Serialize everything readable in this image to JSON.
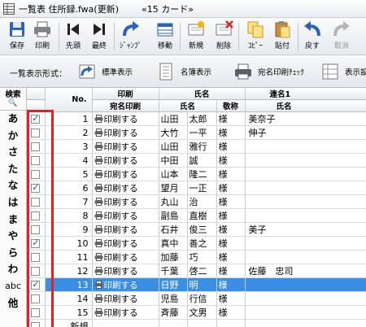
{
  "titlebar": {
    "line1": "一覧表  住所録.fwa(更新)",
    "line2": "«15 カード»"
  },
  "toolbar": [
    {
      "label": "保存",
      "icon": "save-icon",
      "enabled": true
    },
    {
      "label": "印刷",
      "icon": "printer-icon",
      "enabled": true
    },
    {
      "label": "先頭",
      "icon": "first-icon",
      "enabled": true
    },
    {
      "label": "最終",
      "icon": "last-icon",
      "enabled": true
    },
    {
      "label": "ｼﾞｬﾝﾌﾟ",
      "icon": "jump-icon",
      "enabled": true
    },
    {
      "label": "移動",
      "icon": "move-icon",
      "enabled": true
    },
    {
      "label": "新規",
      "icon": "new-card-icon",
      "enabled": true
    },
    {
      "label": "削除",
      "icon": "delete-card-icon",
      "enabled": true
    },
    {
      "label": "ｺﾋﾟｰ",
      "icon": "copy-icon",
      "enabled": true
    },
    {
      "label": "貼付",
      "icon": "paste-icon",
      "enabled": true
    },
    {
      "label": "戻す",
      "icon": "undo-icon",
      "enabled": true
    },
    {
      "label": "取消",
      "icon": "redo-icon",
      "enabled": false
    }
  ],
  "viewbar": {
    "label": "一覧表示形式：",
    "options": [
      {
        "label": "標準表示",
        "icon": "standard-view-icon"
      },
      {
        "label": "名簿表示",
        "icon": "roster-view-icon"
      },
      {
        "label": "宛名印刷ﾁｪｯｸ",
        "icon": "address-print-check-icon"
      },
      {
        "label": "表示設",
        "icon": "display-settings-icon"
      }
    ]
  },
  "index": {
    "header_line1": "検索",
    "header_line2": "🔍",
    "keys": [
      "あ",
      "か",
      "さ",
      "た",
      "な",
      "は",
      "ま",
      "や",
      "ら",
      "わ",
      "abc",
      "他"
    ]
  },
  "grid": {
    "group_headers": {
      "print": "印刷",
      "name": "氏名",
      "joint": "連名1"
    },
    "columns": {
      "no": "No.",
      "address_print": "宛名印刷",
      "name": "氏名",
      "honorific": "敬称",
      "joint_name": "氏名"
    },
    "rows": [
      {
        "checked": true,
        "no": "1",
        "print": "印刷する",
        "last": "山田",
        "first": "太郎",
        "hon": "様",
        "joint": "美奈子"
      },
      {
        "checked": false,
        "no": "2",
        "print": "印刷する",
        "last": "大竹",
        "first": "一平",
        "hon": "様",
        "joint": "伸子"
      },
      {
        "checked": false,
        "no": "3",
        "print": "印刷する",
        "last": "山田",
        "first": "雅行",
        "hon": "様",
        "joint": ""
      },
      {
        "checked": false,
        "no": "4",
        "print": "印刷する",
        "last": "中田",
        "first": "誠",
        "hon": "様",
        "joint": ""
      },
      {
        "checked": false,
        "no": "5",
        "print": "印刷する",
        "last": "山本",
        "first": "隆二",
        "hon": "様",
        "joint": ""
      },
      {
        "checked": true,
        "no": "6",
        "print": "印刷する",
        "last": "望月",
        "first": "一正",
        "hon": "様",
        "joint": ""
      },
      {
        "checked": false,
        "no": "7",
        "print": "印刷する",
        "last": "丸山",
        "first": "治",
        "hon": "様",
        "joint": ""
      },
      {
        "checked": false,
        "no": "8",
        "print": "印刷する",
        "last": "副島",
        "first": "直樹",
        "hon": "様",
        "joint": ""
      },
      {
        "checked": false,
        "no": "9",
        "print": "印刷する",
        "last": "石井",
        "first": "俊三",
        "hon": "様",
        "joint": "美子"
      },
      {
        "checked": true,
        "no": "10",
        "print": "印刷する",
        "last": "真中",
        "first": "善之",
        "hon": "様",
        "joint": ""
      },
      {
        "checked": false,
        "no": "11",
        "print": "印刷する",
        "last": "加藤",
        "first": "巧",
        "hon": "様",
        "joint": ""
      },
      {
        "checked": false,
        "no": "12",
        "print": "印刷する",
        "last": "千葉",
        "first": "啓二",
        "hon": "様",
        "joint": "佐藤　忠司"
      },
      {
        "checked": true,
        "no": "13",
        "print": "印刷する",
        "last": "日野",
        "first": "明",
        "hon": "様",
        "joint": "",
        "highlighted": true
      },
      {
        "checked": false,
        "no": "14",
        "print": "印刷する",
        "last": "児島",
        "first": "行信",
        "hon": "様",
        "joint": ""
      },
      {
        "checked": false,
        "no": "15",
        "print": "印刷する",
        "last": "斉藤",
        "first": "文男",
        "hon": "様",
        "joint": ""
      },
      {
        "checked": false,
        "no": "新規",
        "print": "",
        "last": "",
        "first": "",
        "hon": "",
        "joint": ""
      }
    ]
  },
  "colors": {
    "highlight": "#3a8ee6",
    "annotation": "#ee1c1c",
    "toolbar_blue": "#2a63b8"
  }
}
